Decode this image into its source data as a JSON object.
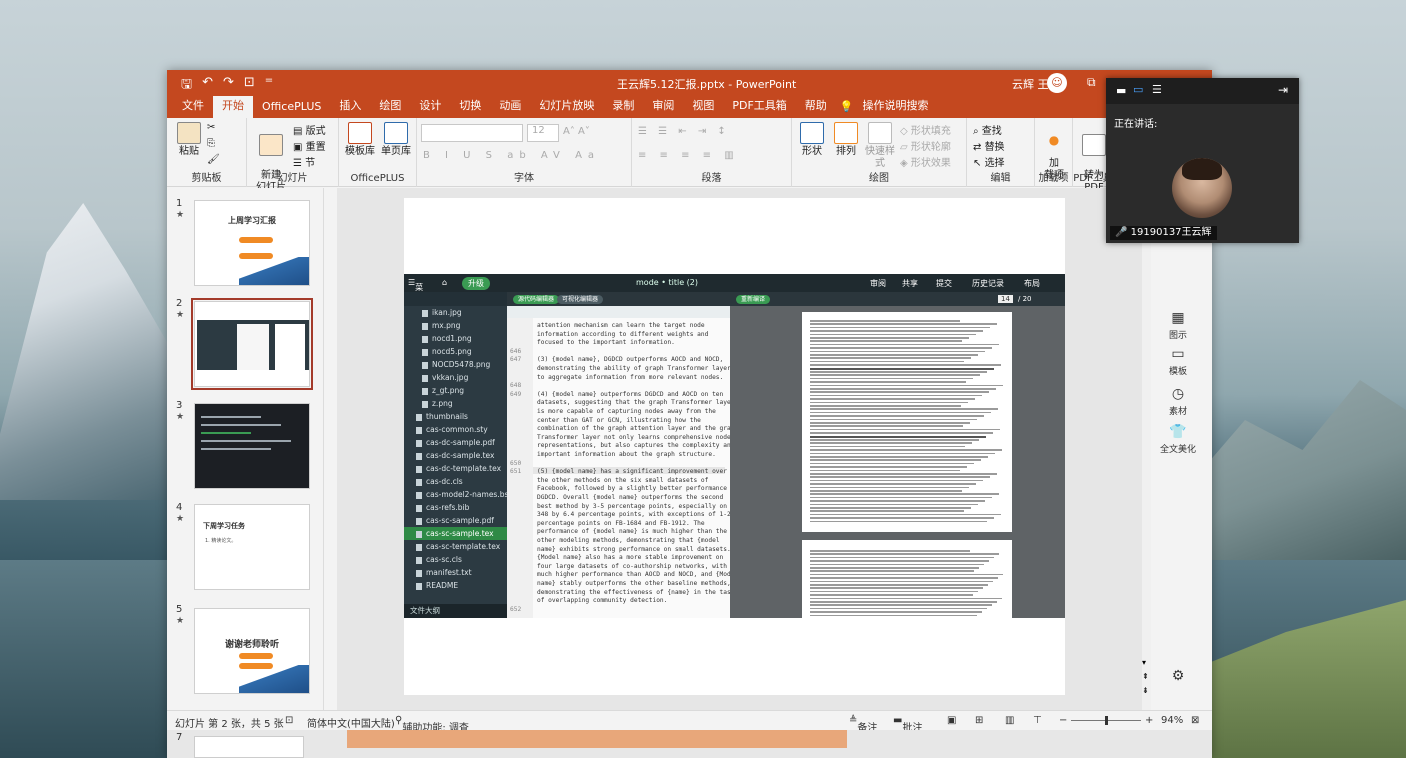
{
  "app": {
    "doc_title": "王云辉5.12汇报.pptx  -  PowerPoint",
    "user_name": "云辉 王",
    "user_initial": "☺"
  },
  "menu": [
    "文件",
    "开始",
    "OfficePLUS",
    "插入",
    "绘图",
    "设计",
    "切换",
    "动画",
    "幻灯片放映",
    "录制",
    "审阅",
    "视图",
    "PDF工具箱",
    "帮助"
  ],
  "menu_active": "开始",
  "tell_me": "操作说明搜索",
  "ribbon": {
    "clipboard": {
      "paste": "粘贴",
      "group": "剪贴板"
    },
    "slides": {
      "new_slide": "新建\n幻灯片",
      "layout": "版式",
      "reset": "重置",
      "section": "节",
      "group": "幻灯片"
    },
    "officeplus": {
      "template": "模板库",
      "single_page": "单页库",
      "group": "OfficePLUS"
    },
    "font": {
      "size": "12",
      "group": "字体"
    },
    "paragraph": {
      "group": "段落"
    },
    "drawing": {
      "shape": "形状",
      "arrange": "排列",
      "quick_style": "快速样式",
      "fill": "形状填充",
      "outline": "形状轮廓",
      "effect": "形状效果",
      "group": "绘图"
    },
    "editing": {
      "find": "查找",
      "replace": "替换",
      "select": "选择",
      "group": "编辑"
    },
    "addins": {
      "load": "加\n载项",
      "group": "加载项"
    },
    "pdf": {
      "convert": "转为\nPDF",
      "group": "PDF工具"
    }
  },
  "thumbnails": [
    {
      "num": "1",
      "title": "上周学习汇报"
    },
    {
      "num": "2",
      "title": ""
    },
    {
      "num": "3",
      "title": ""
    },
    {
      "num": "4",
      "title": "下周学习任务",
      "sub": "1. 精读论文。"
    },
    {
      "num": "5",
      "title": "谢谢老师聆听"
    }
  ],
  "thumb7": "7",
  "overleaf": {
    "menu": "菜单",
    "upgrade": "升级",
    "project": "mode • title (2)",
    "review": "审阅",
    "share": "共享",
    "submit": "提交",
    "history": "历史记录",
    "layout": "布局",
    "code_editor": "源代码编辑器",
    "visual_editor": "可视化编辑器",
    "recompile": "重新编译",
    "page": "14",
    "pages": "/ 20",
    "files": [
      "ikan.jpg",
      "mx.png",
      "nocd1.png",
      "nocd5.png",
      "NOCD5478.png",
      "vkkan.jpg",
      "z_gt.png",
      "z.png",
      "thumbnails",
      "cas-common.sty",
      "cas-dc-sample.pdf",
      "cas-dc-sample.tex",
      "cas-dc-template.tex",
      "cas-dc.cls",
      "cas-model2-names.bst",
      "cas-refs.bib",
      "cas-sc-sample.pdf",
      "cas-sc-sample.tex",
      "cas-sc-template.tex",
      "cas-sc.cls",
      "manifest.txt",
      "README"
    ],
    "file_selected": "cas-sc-sample.tex",
    "outline": "文件大纲",
    "lines": [
      {
        "n": "",
        "t": "attention mechanism can learn the target node"
      },
      {
        "n": "",
        "t": "information according to different weights and"
      },
      {
        "n": "",
        "t": "focused to the important information."
      },
      {
        "n": "646",
        "t": ""
      },
      {
        "n": "647",
        "t": "(3) {model name}, DGDCD outperforms AOCD and NOCD,"
      },
      {
        "n": "",
        "t": "demonstrating the ability of graph Transformer layer"
      },
      {
        "n": "",
        "t": "to aggregate information from more relevant nodes."
      },
      {
        "n": "648",
        "t": ""
      },
      {
        "n": "649",
        "t": "(4) {model name} outperforms DGDCD and AOCD on ten"
      },
      {
        "n": "",
        "t": "datasets, suggesting that the graph Transformer layer"
      },
      {
        "n": "",
        "t": "is more capable of capturing nodes away from the"
      },
      {
        "n": "",
        "t": "center than GAT or GCN, illustrating how the"
      },
      {
        "n": "",
        "t": "combination of the graph attention layer and the graph"
      },
      {
        "n": "",
        "t": "Transformer layer not only learns comprehensive node"
      },
      {
        "n": "",
        "t": "representations, but also captures the complexity and"
      },
      {
        "n": "",
        "t": "important information about the graph structure."
      },
      {
        "n": "650",
        "t": ""
      },
      {
        "n": "651",
        "t": "(5) {model name} has a significant improvement over"
      },
      {
        "n": "",
        "t": "the other methods on the six small datasets of"
      },
      {
        "n": "",
        "t": "Facebook, followed by a slightly better performance of"
      },
      {
        "n": "",
        "t": "DGDCD. Overall {model name} outperforms the second"
      },
      {
        "n": "",
        "t": "best method by 3-5 percentage points, especially on FB-"
      },
      {
        "n": "",
        "t": "348 by 6.4 percentage points, with exceptions of 1-2"
      },
      {
        "n": "",
        "t": "percentage points on FB-1684 and FB-1912. The"
      },
      {
        "n": "",
        "t": "performance of {model name} is much higher than the"
      },
      {
        "n": "",
        "t": "other modeling methods, demonstrating that {model"
      },
      {
        "n": "",
        "t": "name} exhibits strong performance on small datasets."
      },
      {
        "n": "",
        "t": "{Model name} also has a more stable improvement on"
      },
      {
        "n": "",
        "t": "four large datasets of co-authorship networks, with"
      },
      {
        "n": "",
        "t": "much higher performance than AOCD and NOCD, and {Model"
      },
      {
        "n": "",
        "t": "name} stably outperforms the other baseline methods,"
      },
      {
        "n": "",
        "t": "demonstrating the effectiveness of {name} in the task"
      },
      {
        "n": "",
        "t": "of overlapping community detection."
      },
      {
        "n": "652",
        "t": ""
      }
    ]
  },
  "right_pane": [
    {
      "label": "模板",
      "icon": "template-icon"
    },
    {
      "label": "图示",
      "icon": "diagram-icon"
    },
    {
      "label": "素材",
      "icon": "material-icon"
    },
    {
      "label": "全文美化",
      "icon": "beautify-icon"
    }
  ],
  "status": {
    "slide_info": "幻灯片 第 2 张，共 5 张",
    "language": "简体中文(中国大陆)",
    "accessibility": "辅助功能: 调查",
    "notes": "备注",
    "comments": "批注",
    "zoom": "94%",
    "zoom_level": 0.5
  },
  "meeting": {
    "speaking_label": "正在讲话:",
    "speaker_name": "19190137王云辉"
  },
  "colors": {
    "accent": "#c4481f",
    "overleaf_green": "#3a9b53"
  }
}
